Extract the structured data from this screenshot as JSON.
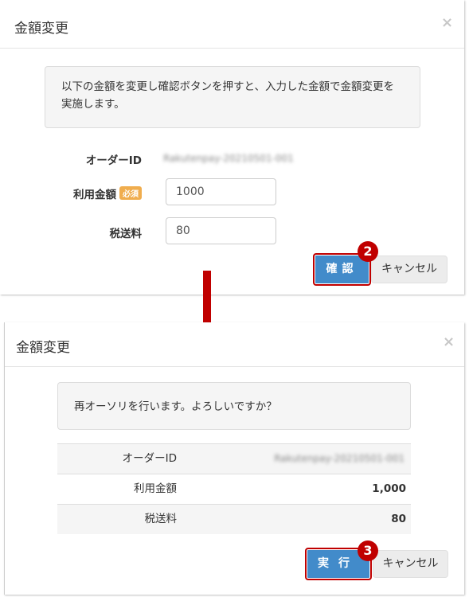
{
  "dialog1": {
    "title": "金額変更",
    "close": "×",
    "notice": "以下の金額を変更し確認ボタンを押すと、入力した金額で金額変更を実施します。",
    "order_label": "オーダーID",
    "order_value": "Rakutenpay-20210501-001",
    "amount_label": "利用金額",
    "required_badge": "必須",
    "amount_value": "1000",
    "shipping_label": "税送料",
    "shipping_value": "80",
    "confirm_button": "確認",
    "cancel_button": "キャンセル",
    "marker": "2"
  },
  "dialog2": {
    "title": "金額変更",
    "close": "×",
    "notice": "再オーソリを行います。よろしいですか？",
    "rows": [
      {
        "label": "オーダーID",
        "value": "Rakutenpay-20210501-001"
      },
      {
        "label": "利用金額",
        "value": "1,000"
      },
      {
        "label": "税送料",
        "value": "80"
      }
    ],
    "execute_button": "実行",
    "cancel_button": "キャンセル",
    "marker": "3"
  },
  "colors": {
    "accent": "#428bca",
    "highlight": "#c00000",
    "badge": "#f0ad4e"
  }
}
